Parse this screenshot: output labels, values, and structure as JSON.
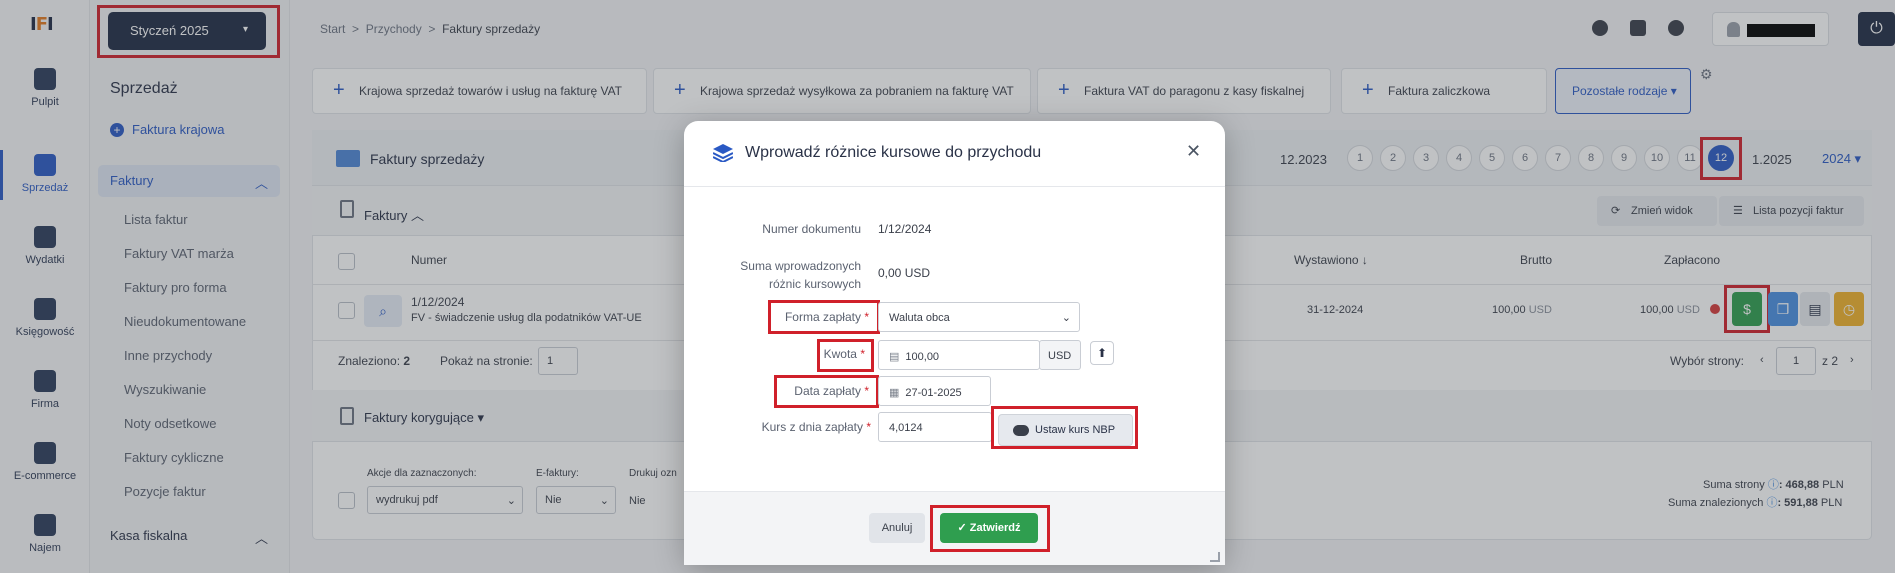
{
  "logo": {
    "text_a": "I",
    "text_b": "F",
    "text_c": "I"
  },
  "rail": [
    {
      "label": "Pulpit",
      "icon": "dashboard-icon"
    },
    {
      "label": "Sprzedaż",
      "icon": "sales-document-icon"
    },
    {
      "label": "Wydatki",
      "icon": "expenses-icon"
    },
    {
      "label": "Księgowość",
      "icon": "accounting-icon"
    },
    {
      "label": "Firma",
      "icon": "briefcase-icon"
    },
    {
      "label": "E-commerce",
      "icon": "cart-icon"
    },
    {
      "label": "Najem",
      "icon": "building-icon"
    }
  ],
  "month_selector": {
    "label": "Styczeń 2025"
  },
  "sidebar": {
    "title": "Sprzedaż",
    "new_link": "Faktura krajowa",
    "group": "Faktury",
    "items": [
      "Lista faktur",
      "Faktury VAT marża",
      "Faktury pro forma",
      "Nieudokumentowane",
      "Inne przychody",
      "Wyszukiwanie",
      "Noty odsetkowe",
      "Faktury cykliczne",
      "Pozycje faktur"
    ],
    "section_2": "Kasa fiskalna"
  },
  "breadcrumb": {
    "b1": "Start",
    "b2": "Przychody",
    "b3": "Faktury sprzedaży"
  },
  "quick_add": {
    "q1": "Krajowa sprzedaż towarów i usług na fakturę VAT",
    "q2": "Krajowa sprzedaż wysyłkowa za pobraniem na fakturę VAT",
    "q3": "Faktura VAT do paragonu z kasy fiskalnej",
    "q4": "Faktura zaliczkowa",
    "other": "Pozostałe rodzaje"
  },
  "panel": {
    "title": "Faktury sprzedaży",
    "prev_period": "12.2023",
    "months": [
      "1",
      "2",
      "3",
      "4",
      "5",
      "6",
      "7",
      "8",
      "9",
      "10",
      "11",
      "12"
    ],
    "next_period": "1.2025",
    "year": "2024"
  },
  "invoices": {
    "title": "Faktury",
    "change_view": "Zmień widok",
    "positions_list": "Lista pozycji faktur",
    "columns": {
      "number": "Numer",
      "issued": "Wystawiono",
      "gross": "Brutto",
      "paid": "Zapłacono"
    },
    "row": {
      "number": "1/12/2024",
      "desc": "FV - świadczenie usług dla podatników VAT-UE",
      "issued": "31-12-2024",
      "gross_value": "100,00",
      "gross_cur": "USD",
      "paid_value": "100,00",
      "paid_cur": "USD"
    },
    "found_label": "Znaleziono:",
    "found_count": "2",
    "per_page_label": "Pokaż na stronie:",
    "per_page": "1",
    "page_select": "Wybór strony:",
    "page_current": "1",
    "page_of": "z",
    "page_total": "2"
  },
  "corrections": {
    "title": "Faktury korygujące",
    "bulk_label": "Akcje dla zaznaczonych:",
    "bulk_value": "wydrukuj pdf",
    "einv_label": "E-faktury:",
    "einv_value": "Nie",
    "print_label": "Drukuj ozn",
    "print_value": "Nie",
    "page_sum_label": "Suma strony",
    "page_sum": ": 468,88",
    "page_sum_cur": "PLN",
    "found_sum_label": "Suma znalezionych",
    "found_sum": ": 591,88",
    "found_sum_cur": "PLN"
  },
  "modal": {
    "title": "Wprowadź różnice kursowe do przychodu",
    "doc_label": "Numer dokumentu",
    "doc_value": "1/12/2024",
    "sum_label_1": "Suma wprowadzonych",
    "sum_label_2": "różnic kursowych",
    "sum_value": "0,00 USD",
    "payment_form_label": "Forma zapłaty",
    "payment_form_value": "Waluta obca",
    "amount_label": "Kwota",
    "amount_value": "100,00",
    "amount_currency": "USD",
    "date_label": "Data zapłaty",
    "date_value": "27-01-2025",
    "rate_label": "Kurs z dnia zapłaty",
    "rate_value": "4,0124",
    "nbp_button": "Ustaw kurs NBP",
    "cancel": "Anuluj",
    "confirm": "Zatwierdź",
    "required_mark": "*"
  },
  "colors": {
    "accent": "#2a59c4",
    "highlight": "#d0202a",
    "success": "#2f9e4f",
    "dark": "#1f2b45"
  }
}
